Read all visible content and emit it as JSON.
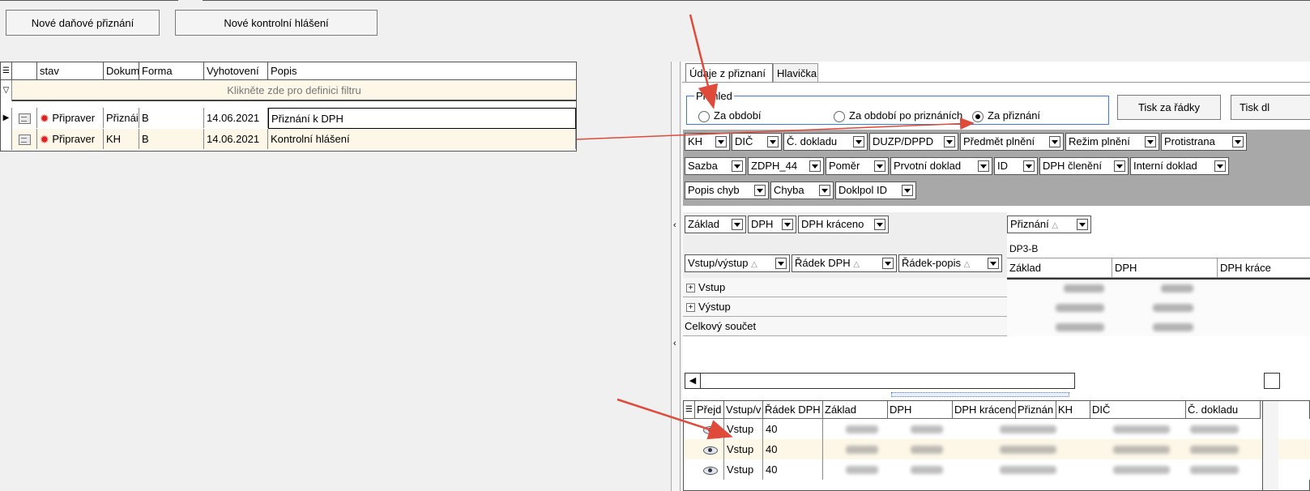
{
  "toolbar": {
    "new_tax_return": "Nové daňové přiznání",
    "new_control_report": "Nové kontrolní hlášení"
  },
  "left_grid": {
    "columns": [
      "stav",
      "Dokum",
      "Forma",
      "Vyhotovení",
      "Popis"
    ],
    "filter_hint": "Klikněte zde pro definici filtru",
    "rows": [
      {
        "stav": "Připraver",
        "dokum": "Přiznái",
        "forma": "B",
        "vyhotoveni": "14.06.2021",
        "popis": "Přiznání k DPH"
      },
      {
        "stav": "Připraver",
        "dokum": "KH",
        "forma": "B",
        "vyhotoveni": "14.06.2021",
        "popis": "Kontrolní hlášení"
      }
    ]
  },
  "right_panel": {
    "tabs": [
      "Údaje z přiznaní",
      "Hlavička"
    ],
    "group_title": "Přehled",
    "radios": [
      "Za období",
      "Za období po priznáních",
      "Za přiznání"
    ],
    "print_rows": "Tisk za řádky",
    "print_other": "Tisk dl",
    "filter_row1": [
      "KH",
      "DIČ",
      "Č. dokladu",
      "DUZP/DPPD",
      "Předmět plnění",
      "Režim plnění",
      "Protistrana"
    ],
    "filter_row2": [
      "Sazba",
      "ZDPH_44",
      "Poměr",
      "Prvotní doklad",
      "ID",
      "DPH členění",
      "Interní doklad"
    ],
    "filter_row3": [
      "Popis chyb",
      "Chyba",
      "Doklpol ID"
    ],
    "data_fields": [
      "Základ",
      "DPH",
      "DPH kráceno"
    ],
    "column_field": "Přiznání",
    "column_value": "DP3-B",
    "value_headers": [
      "Základ",
      "DPH",
      "DPH krácе"
    ],
    "row_fields": [
      "Vstup/výstup",
      "Řádek DPH",
      "Řádek-popis"
    ],
    "pivot_rows": [
      "Vstup",
      "Výstup",
      "Celkový součet"
    ]
  },
  "bottom_grid": {
    "columns": [
      "Přejd",
      "Vstup/v",
      "Řádek DPH",
      "Základ",
      "DPH",
      "DPH kráceno",
      "Přiznán",
      "KH",
      "DIČ",
      "Č. dokladu"
    ],
    "rows": [
      {
        "vstup": "Vstup",
        "radek": "40"
      },
      {
        "vstup": "Vstup",
        "radek": "40"
      },
      {
        "vstup": "Vstup",
        "radek": "40"
      }
    ]
  },
  "colors": {
    "annotation_arrow": "#e04a3a",
    "accent_border": "#3b7bd4",
    "highlight_row": "#fdf7e8"
  }
}
